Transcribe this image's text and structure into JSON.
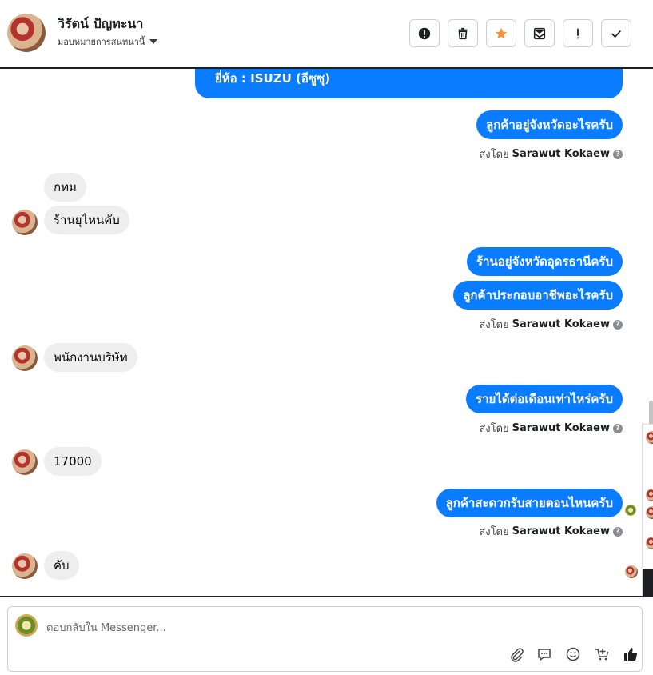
{
  "header": {
    "customer_name": "วิรัตน์ ปัญทะนา",
    "assign_label": "มอบหมายการสนทนานี้",
    "actions": [
      {
        "name": "spam-button",
        "icon": "exclamation-circle-icon"
      },
      {
        "name": "delete-button",
        "icon": "trash-icon"
      },
      {
        "name": "star-button",
        "icon": "star-icon"
      },
      {
        "name": "mark-unread-button",
        "icon": "envelope-icon"
      },
      {
        "name": "follow-up-button",
        "icon": "exclamation-icon"
      },
      {
        "name": "done-button",
        "icon": "check-icon"
      }
    ],
    "colors": {
      "star": "#f7923b",
      "border": "#ccd0d5"
    }
  },
  "messages": {
    "m0": "ยี่ห้อ : ISUZU (อีซูซุ)",
    "m1": "ลูกค้าอยู่จังหวัดอะไรครับ",
    "m2": "กทม",
    "m3": "ร้านยุไหนคับ",
    "m4": "ร้านอยู่จังหวัดอุดรธานีครับ",
    "m5": "ลูกค้าประกอบอาชีพอะไรครับ",
    "m6": "พนักงานบริษัท",
    "m7": "รายได้ต่อเดือนเท่าไหร่ครับ",
    "m8": "17000",
    "m9": "ลูกค้าสะดวกรับสายตอนไหนครับ",
    "m10": "คับ"
  },
  "sent_by": {
    "prefix": "ส่งโดย",
    "agent": "Sarawut Kokaew",
    "help": "?"
  },
  "composer": {
    "placeholder": "ตอบกลับใน Messenger...",
    "tools": [
      "paperclip-icon",
      "chat-bubble-icon",
      "smiley-icon",
      "add-to-cart-icon",
      "thumbs-up-icon"
    ]
  },
  "theme": {
    "outgoing": "#0a7cff",
    "incoming": "#eeeeee"
  }
}
